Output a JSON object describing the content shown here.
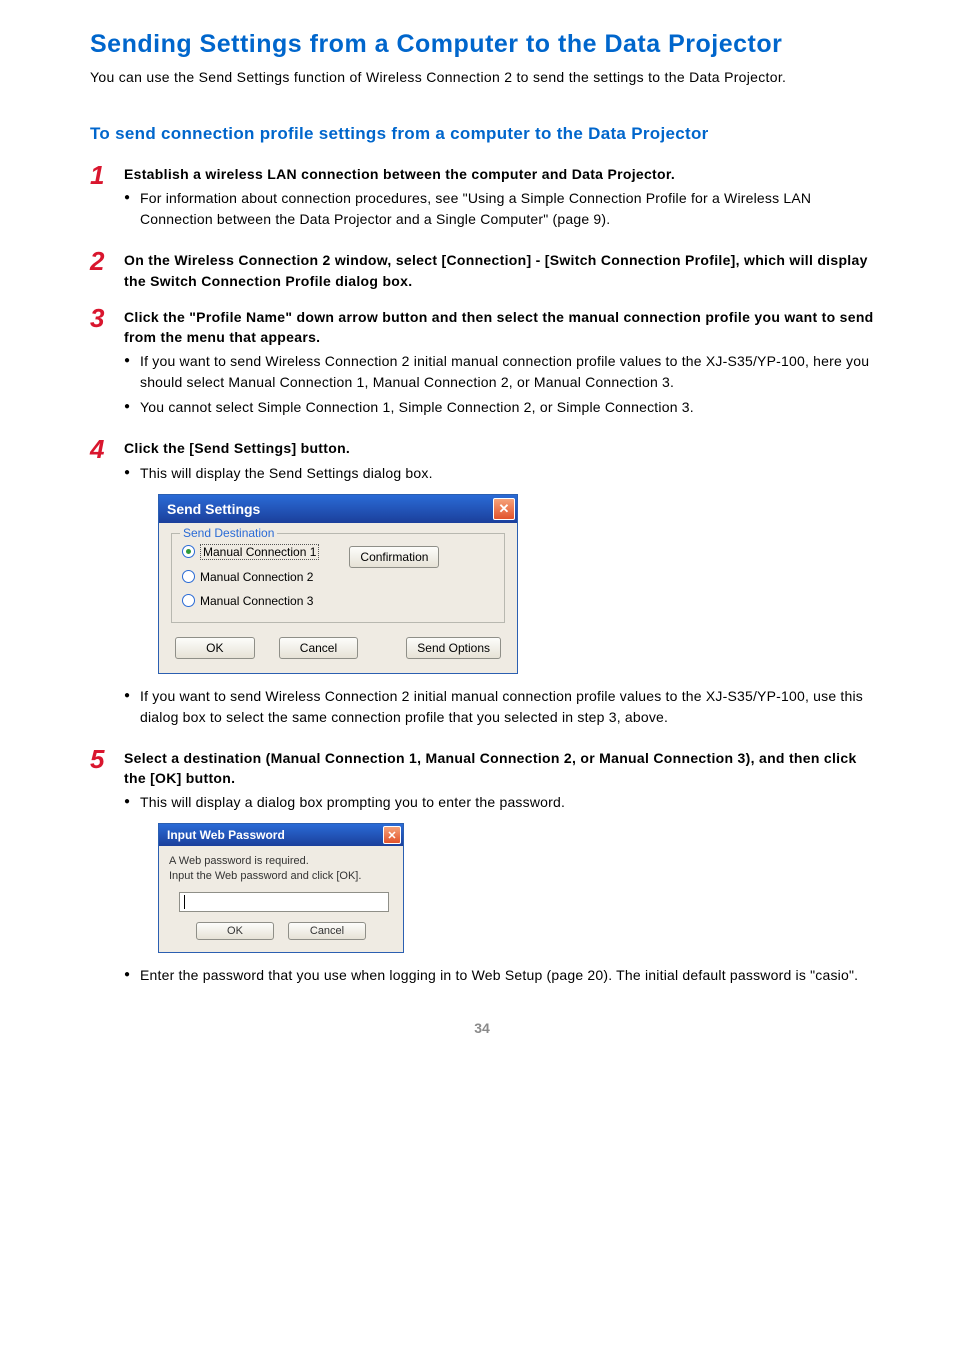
{
  "title": "Sending Settings from a Computer to the Data Projector",
  "intro": "You can use the Send Settings function of Wireless Connection 2 to send the settings to the Data Projector.",
  "section_title": "To send connection profile settings from a computer to the Data Projector",
  "steps": [
    {
      "num": "1",
      "head": "Establish a wireless LAN connection between the computer and Data Projector.",
      "bullets": [
        "For information about connection procedures, see \"Using a Simple Connection Profile for a Wireless LAN Connection between the Data Projector and a Single Computer\" (page 9)."
      ]
    },
    {
      "num": "2",
      "head": "On the Wireless Connection 2 window, select [Connection] - [Switch Connection Profile], which will display the Switch Connection Profile dialog box.",
      "bullets": []
    },
    {
      "num": "3",
      "head": "Click the \"Profile Name\" down arrow button and then select the manual connection profile you want to send from the menu that appears.",
      "bullets": [
        "If you want to send Wireless Connection 2 initial manual connection profile values to the XJ-S35/YP-100, here you should select Manual Connection 1, Manual Connection 2, or Manual Connection 3.",
        "You cannot select Simple Connection 1, Simple Connection 2, or Simple Connection 3."
      ]
    },
    {
      "num": "4",
      "head": "Click the [Send Settings] button.",
      "bullets": [
        "This will display the Send Settings dialog box."
      ],
      "after_bullets": [
        "If you want to send Wireless Connection 2 initial manual connection profile values to the XJ-S35/YP-100, use this dialog box to select the same connection profile that you selected in step 3, above."
      ]
    },
    {
      "num": "5",
      "head": "Select a destination (Manual Connection 1, Manual Connection 2, or Manual Connection 3), and then click the [OK] button.",
      "bullets": [
        "This will display a dialog box prompting you to enter the password."
      ],
      "after_bullets": [
        "Enter the password that you use when logging in to Web Setup (page 20). The initial default password is \"casio\"."
      ]
    }
  ],
  "dialog1": {
    "title": "Send Settings",
    "legend": "Send Destination",
    "options": [
      "Manual Connection 1",
      "Manual Connection 2",
      "Manual Connection 3"
    ],
    "confirm": "Confirmation",
    "ok": "OK",
    "cancel": "Cancel",
    "send_options": "Send Options"
  },
  "dialog2": {
    "title": "Input Web Password",
    "text1": "A Web password is required.",
    "text2": "Input the Web password and click [OK].",
    "ok": "OK",
    "cancel": "Cancel"
  },
  "page_number": "34"
}
